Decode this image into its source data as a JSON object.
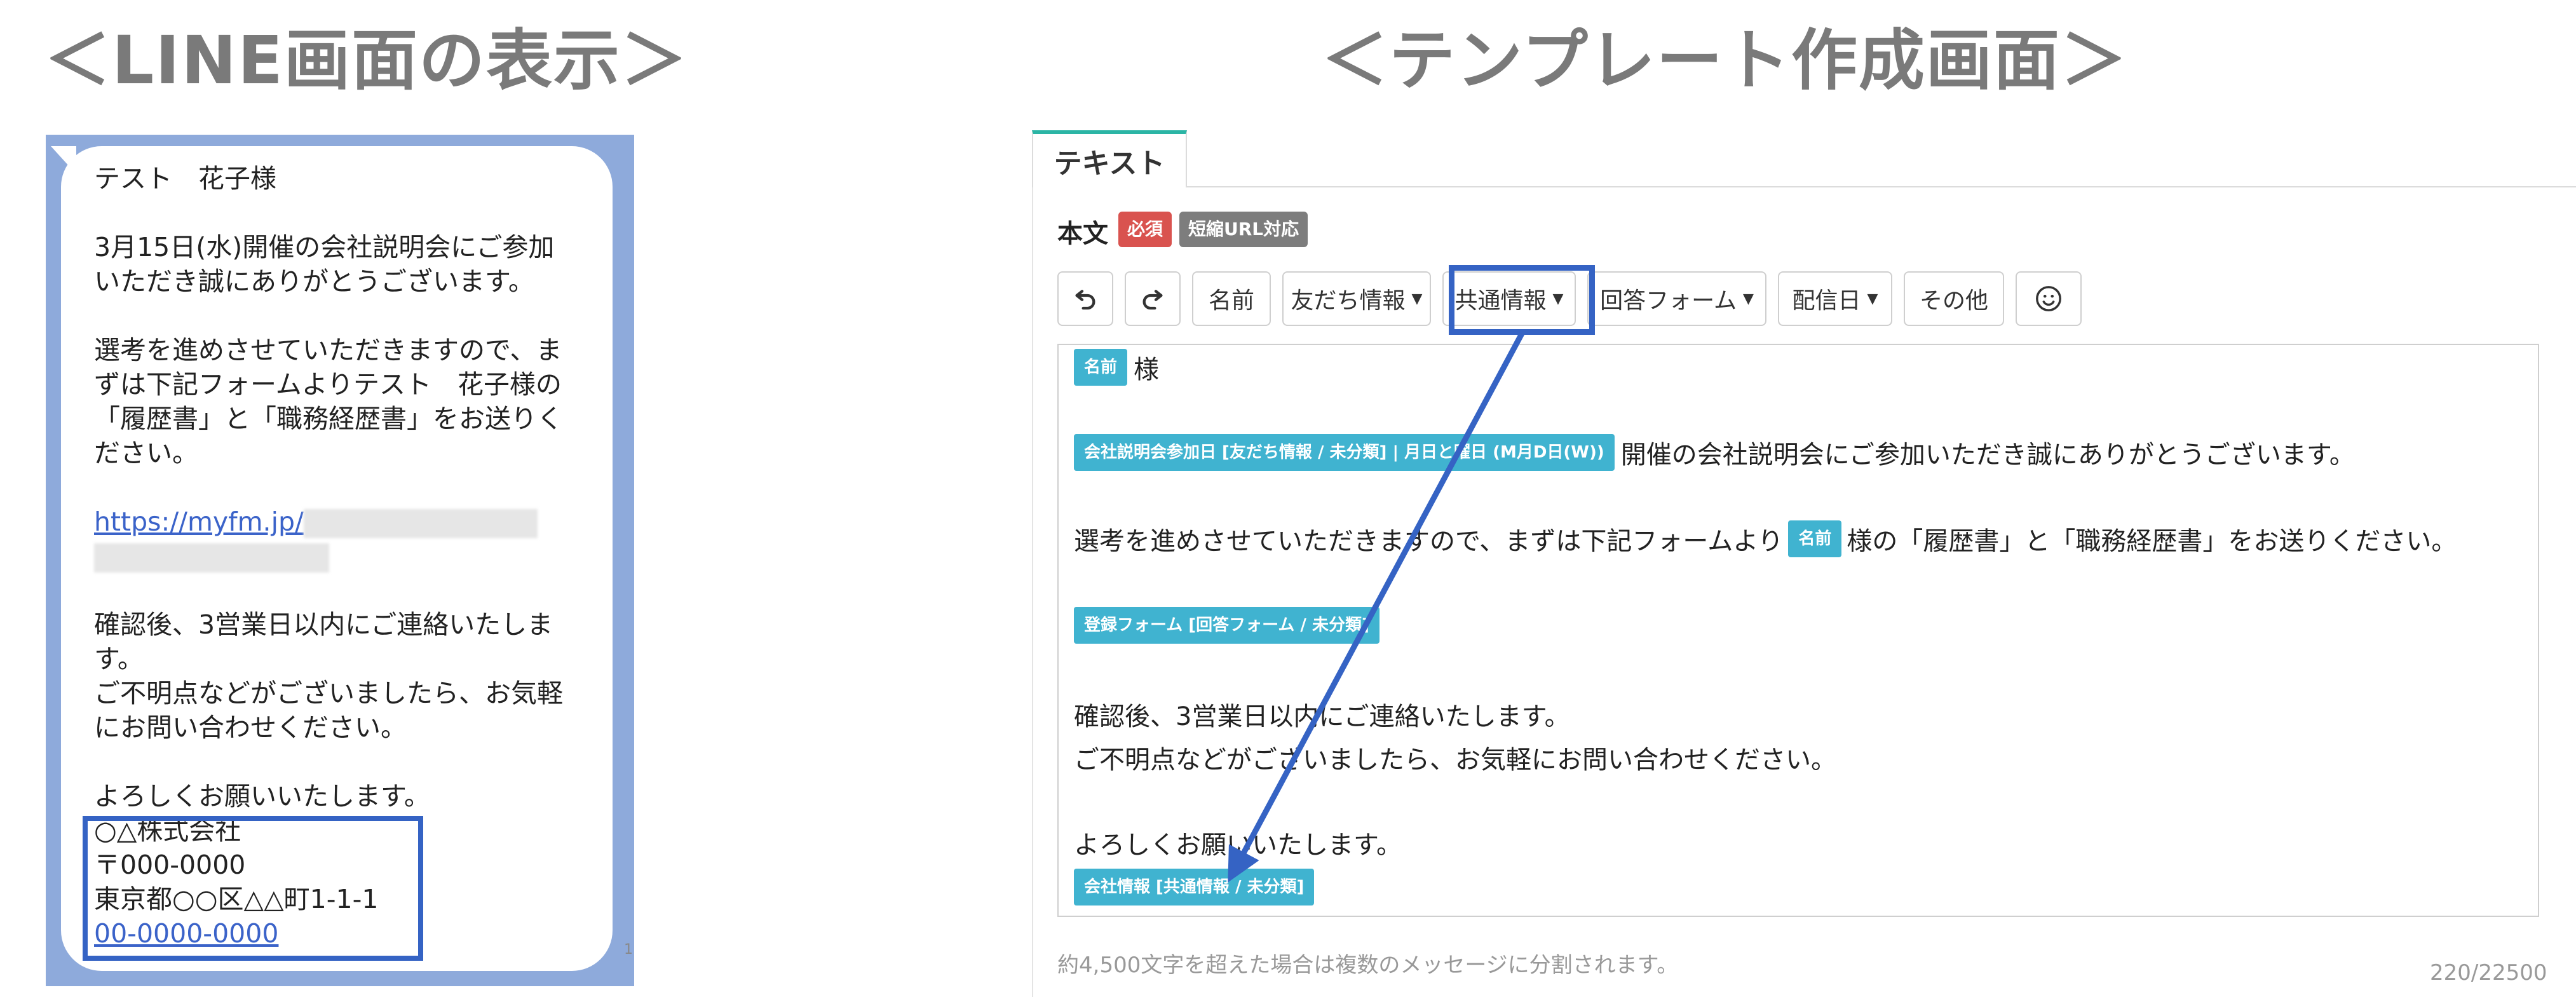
{
  "headings": {
    "left": "＜LINE画面の表示＞",
    "right": "＜テンプレート作成画面＞"
  },
  "line_preview": {
    "greeting": "テスト　花子様",
    "para1_line1": "3月15日(水)開催の会社説明会にご参加",
    "para1_line2": "いただき誠にありがとうございます。",
    "para2_line1": "選考を進めさせていただきますので、ま",
    "para2_line2": "ずは下記フォームよりテスト　花子様の",
    "para2_line3": "「履歴書」と「職務経歴書」をお送りく",
    "para2_line4": "ださい。",
    "link": "https://myfm.jp/",
    "para3_line1": "確認後、3営業日以内にご連絡いたしま",
    "para3_line2": "す。",
    "para3_line3": "ご不明点などがございましたら、お気軽",
    "para3_line4": "にお問い合わせください。",
    "closing": "よろしくお願いいたします。",
    "company_name": "○△株式会社",
    "postal": "〒000-0000",
    "address": "東京都○○区△△町1-1-1",
    "phone": "00-0000-0000",
    "page_number": "1"
  },
  "editor": {
    "tab_label": "テキスト",
    "field_label": "本文",
    "badge_required": "必須",
    "badge_shorturl": "短縮URL対応",
    "toolbar": {
      "undo_icon": "undo-icon",
      "redo_icon": "redo-icon",
      "name": "名前",
      "friend_info": "友だち情報",
      "common_info": "共通情報",
      "answer_form": "回答フォーム",
      "delivery_date": "配信日",
      "other": "その他",
      "emoji_icon": "smiley-icon"
    },
    "body": {
      "tag_name": "名前",
      "honorific": "様",
      "tag_event_date": "会社説明会参加日 [友だち情報 / 未分類] | 月日と曜日 (M月D日(W))",
      "line2_text": "開催の会社説明会にご参加いただき誠にありがとうございます。",
      "line3_pre": "選考を進めさせていただきますので、まずは下記フォームより",
      "line3_tag": "名前",
      "line3_post": "様の「履歴書」と「職務経歴書」をお送りください。",
      "tag_form": "登録フォーム [回答フォーム / 未分類]",
      "line5": "確認後、3営業日以内にご連絡いたします。",
      "line6": "ご不明点などがございましたら、お気軽にお問い合わせください。",
      "line7": "よろしくお願いいたします。",
      "tag_company": "会社情報 [共通情報 / 未分類]"
    },
    "hint": "約4,500文字を超えた場合は複数のメッセージに分割されます。",
    "counter": "220/22500"
  },
  "colors": {
    "heading": "#7a7a7a",
    "line_bg": "#8eaadb",
    "highlight": "#3563c4",
    "tag": "#40b3d0",
    "required": "#d9534f",
    "tab_accent": "#2bb5a5"
  }
}
